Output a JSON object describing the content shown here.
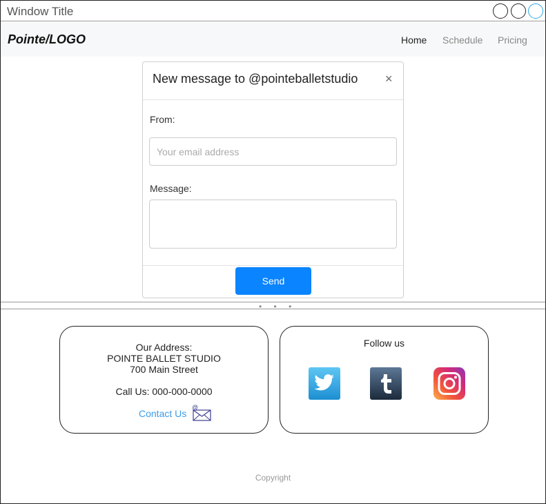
{
  "window": {
    "title": "Window Title"
  },
  "nav": {
    "logo": "Pointe/LOGO",
    "links": [
      {
        "label": "Home"
      },
      {
        "label": "Schedule"
      },
      {
        "label": "Pricing"
      }
    ]
  },
  "modal": {
    "title": "New message to @pointeballetstudio",
    "close": "×",
    "from_label": "From:",
    "email_placeholder": "Your email address",
    "message_label": "Message:",
    "send_label": "Send"
  },
  "splitter": {
    "handle": "• • •"
  },
  "address": {
    "heading": "Our Address:",
    "studio": "POINTE BALLET STUDIO",
    "street": "700 Main Street",
    "phone": "Call Us: 000-000-0000",
    "contact": "Contact Us"
  },
  "follow": {
    "title": "Follow us",
    "networks": [
      "twitter-icon",
      "tumblr-icon",
      "instagram-icon"
    ]
  },
  "footer": {
    "copyright": "Copyright"
  },
  "colors": {
    "accent": "#0a84ff",
    "link": "#3b9be9",
    "navbar_bg": "#f7f8f9"
  }
}
